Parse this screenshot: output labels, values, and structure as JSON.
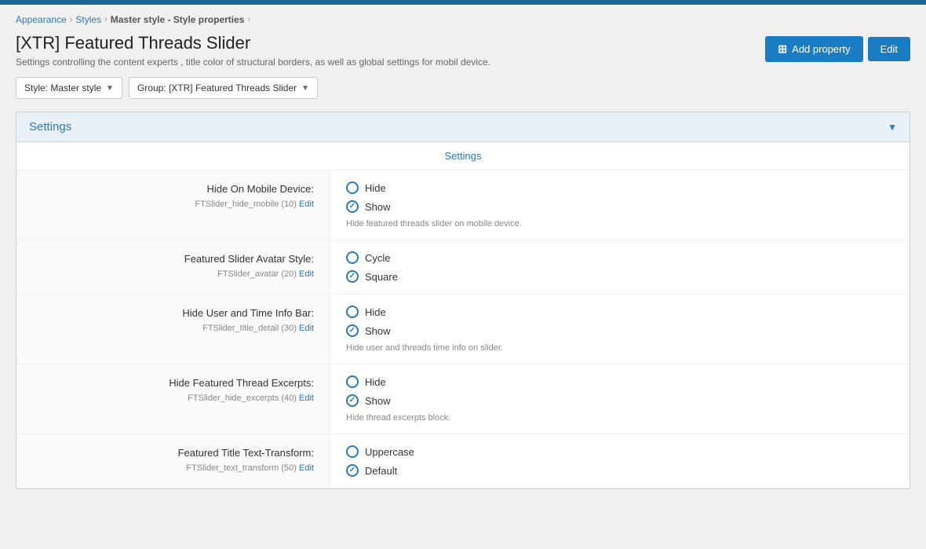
{
  "topbar": {},
  "breadcrumb": {
    "items": [
      {
        "label": "Appearance",
        "href": "#"
      },
      {
        "label": "Styles",
        "href": "#"
      },
      {
        "label": "Master style - Style properties",
        "href": "#",
        "bold": false
      }
    ]
  },
  "header": {
    "title": "[XTR] Featured Threads Slider",
    "subtitle": "Settings controlling the content experts , title color of structural borders, as well as global settings for mobil device.",
    "add_property_label": "Add property",
    "edit_label": "Edit"
  },
  "filters": {
    "style_label": "Style: Master style",
    "group_label": "Group: [XTR] Featured Threads Slider"
  },
  "settings_panel": {
    "title": "Settings",
    "sub_header": "Settings",
    "collapse_icon": "▼",
    "rows": [
      {
        "label": "Hide On Mobile Device:",
        "meta": "FTSlider_hide_mobile (10)",
        "meta_edit": "Edit",
        "options": [
          {
            "label": "Hide",
            "checked": false
          },
          {
            "label": "Show",
            "checked": true
          }
        ],
        "hint": "Hide featured threads slider on mobile device."
      },
      {
        "label": "Featured Slider Avatar Style:",
        "meta": "FTSlider_avatar (20)",
        "meta_edit": "Edit",
        "options": [
          {
            "label": "Cycle",
            "checked": false
          },
          {
            "label": "Square",
            "checked": true
          }
        ],
        "hint": ""
      },
      {
        "label": "Hide User and Time Info Bar:",
        "meta": "FTSlider_title_detail (30)",
        "meta_edit": "Edit",
        "options": [
          {
            "label": "Hide",
            "checked": false
          },
          {
            "label": "Show",
            "checked": true
          }
        ],
        "hint": "Hide user and threads time info on slider."
      },
      {
        "label": "Hide Featured Thread Excerpts:",
        "meta": "FTSlider_hide_excerpts (40)",
        "meta_edit": "Edit",
        "options": [
          {
            "label": "Hide",
            "checked": false
          },
          {
            "label": "Show",
            "checked": true
          }
        ],
        "hint": "Hide thread excerpts block."
      },
      {
        "label": "Featured Title Text-Transform:",
        "meta": "FTSlider_text_transform (50)",
        "meta_edit": "Edit",
        "options": [
          {
            "label": "Uppercase",
            "checked": false
          },
          {
            "label": "Default",
            "checked": true
          }
        ],
        "hint": ""
      }
    ]
  }
}
